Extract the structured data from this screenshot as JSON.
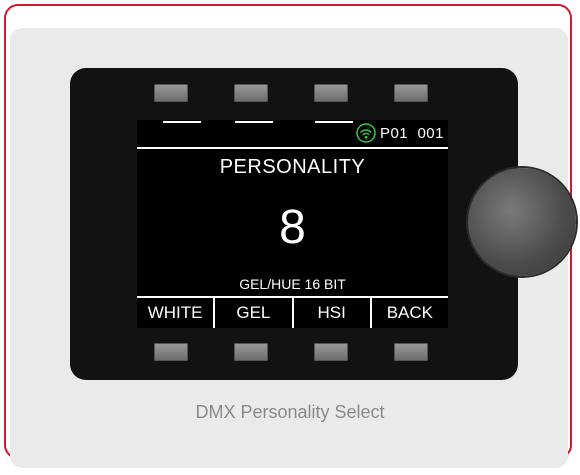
{
  "status": {
    "text": "P01  001",
    "wifi_color": "#2ecc40"
  },
  "display": {
    "title": "PERSONALITY",
    "value": "8",
    "subtitle": "GEL/HUE 16 BIT"
  },
  "softkeys": [
    "WHITE",
    "GEL",
    "HSI",
    "BACK"
  ],
  "caption": "DMX Personality Select",
  "colors": {
    "border_accent": "#cc1a2e",
    "panel": "#eaeaea",
    "device": "#121212"
  }
}
